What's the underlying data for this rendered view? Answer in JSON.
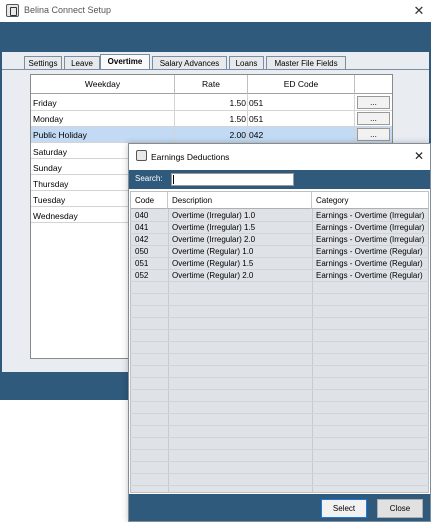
{
  "window": {
    "title": "Belina Connect Setup",
    "close_glyph": "✕"
  },
  "tabs": [
    {
      "label": "Settings"
    },
    {
      "label": "Leave"
    },
    {
      "label": "Overtime"
    },
    {
      "label": "Salary Advances"
    },
    {
      "label": "Loans"
    },
    {
      "label": "Master File Fields"
    }
  ],
  "grid": {
    "headers": {
      "weekday": "Weekday",
      "rate": "Rate",
      "ed_code": "ED Code"
    },
    "rows": [
      {
        "weekday": "Friday",
        "rate": "1.50",
        "ed_code": "051",
        "button": "..."
      },
      {
        "weekday": "Monday",
        "rate": "1.50",
        "ed_code": "051",
        "button": "..."
      },
      {
        "weekday": "Public Holiday",
        "rate": "2.00",
        "ed_code": "042",
        "button": "..."
      },
      {
        "weekday": "Saturday"
      },
      {
        "weekday": "Sunday"
      },
      {
        "weekday": "Thursday"
      },
      {
        "weekday": "Tuesday"
      },
      {
        "weekday": "Wednesday"
      }
    ]
  },
  "dialog": {
    "title": "Earnings Deductions",
    "close_glyph": "✕",
    "search_label": "Search:",
    "search_value": "",
    "headers": {
      "code": "Code",
      "description": "Description",
      "category": "Category"
    },
    "rows": [
      {
        "code": "040",
        "description": "Overtime (Irregular) 1.0",
        "category": "Earnings - Overtime (Irregular)"
      },
      {
        "code": "041",
        "description": "Overtime (Irregular) 1.5",
        "category": "Earnings - Overtime (Irregular)"
      },
      {
        "code": "042",
        "description": "Overtime (Irregular) 2.0",
        "category": "Earnings - Overtime (Irregular)"
      },
      {
        "code": "050",
        "description": "Overtime (Regular) 1.0",
        "category": "Earnings - Overtime (Regular)"
      },
      {
        "code": "051",
        "description": "Overtime (Regular) 1.5",
        "category": "Earnings - Overtime (Regular)"
      },
      {
        "code": "052",
        "description": "Overtime (Regular) 2.0",
        "category": "Earnings - Overtime (Regular)"
      }
    ],
    "buttons": {
      "select": "Select",
      "close": "Close"
    }
  },
  "colors": {
    "panel_blue": "#2f5a7c",
    "selected_row": "#c3daf4",
    "list_bg": "#dfe3e7"
  }
}
